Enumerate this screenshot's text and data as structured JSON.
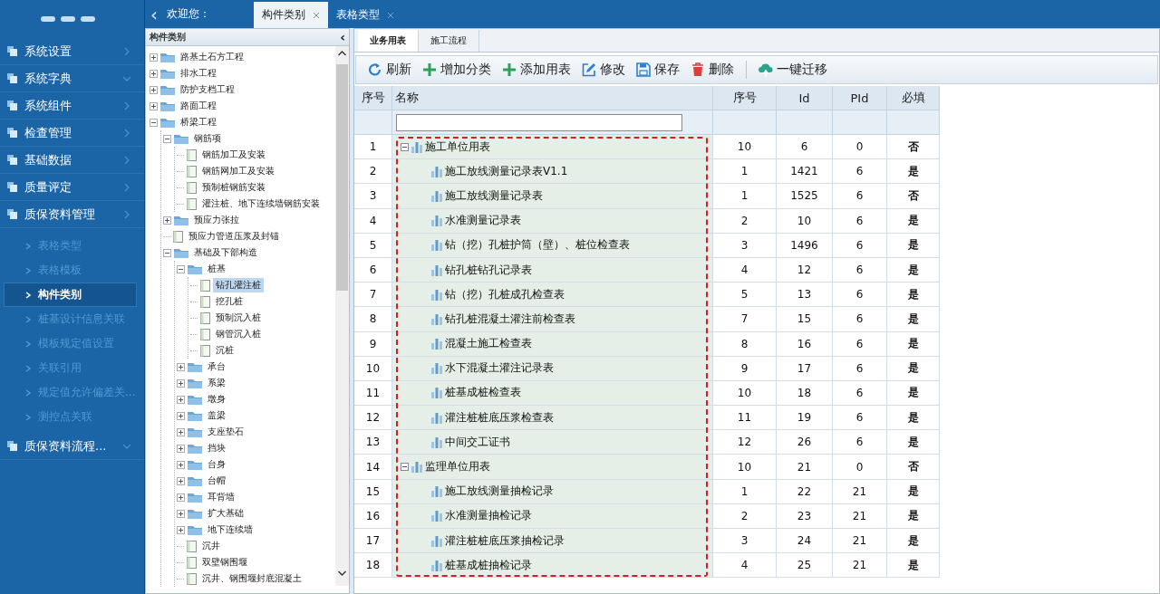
{
  "top_bar": {
    "collapse": "‹",
    "welcome": "欢迎您：",
    "tabs": [
      {
        "label": "构件类别",
        "selected": true
      },
      {
        "label": "表格类型",
        "selected": false
      }
    ]
  },
  "sidebar": {
    "items": [
      {
        "kind": "group",
        "label": "系统设置",
        "expanded": false
      },
      {
        "kind": "group",
        "label": "系统字典",
        "expanded": true
      },
      {
        "kind": "group",
        "label": "系统组件",
        "expanded": false
      },
      {
        "kind": "group",
        "label": "检查管理",
        "expanded": false
      },
      {
        "kind": "group",
        "label": "基础数据",
        "expanded": false
      },
      {
        "kind": "group",
        "label": "质量评定",
        "expanded": false
      },
      {
        "kind": "group",
        "label": "质保资料管理",
        "expanded": false
      },
      {
        "kind": "sub",
        "label": "表格类型",
        "selected": false
      },
      {
        "kind": "sub",
        "label": "表格模板",
        "selected": false
      },
      {
        "kind": "sub",
        "label": "构件类别",
        "selected": true
      },
      {
        "kind": "sub",
        "label": "桩基设计信息关联",
        "selected": false
      },
      {
        "kind": "sub",
        "label": "模板规定值设置",
        "selected": false
      },
      {
        "kind": "sub",
        "label": "关联引用",
        "selected": false
      },
      {
        "kind": "sub",
        "label": "规定值允许偏差关...",
        "selected": false
      },
      {
        "kind": "sub",
        "label": "测控点关联",
        "selected": false
      },
      {
        "kind": "group",
        "label": "质保资料流程...",
        "expanded": true
      }
    ]
  },
  "tree_panel": {
    "title": "构件类别",
    "collapse": "‹",
    "nodes": [
      {
        "kind": "folder",
        "label": "路基土石方工程",
        "expanded": false
      },
      {
        "kind": "folder",
        "label": "排水工程",
        "expanded": false
      },
      {
        "kind": "folder",
        "label": "防护支档工程",
        "expanded": false
      },
      {
        "kind": "folder",
        "label": "路面工程",
        "expanded": false
      },
      {
        "kind": "folder",
        "label": "桥梁工程",
        "expanded": true,
        "children": [
          {
            "kind": "folder",
            "label": "钢筋项",
            "expanded": true,
            "children": [
              {
                "kind": "file",
                "label": "钢筋加工及安装",
                "selected": false
              },
              {
                "kind": "file",
                "label": "钢筋网加工及安装",
                "selected": false
              },
              {
                "kind": "file",
                "label": "预制桩钢筋安装",
                "selected": false
              },
              {
                "kind": "file",
                "label": "灌注桩、地下连续墙钢筋安装",
                "selected": false
              }
            ]
          },
          {
            "kind": "folder",
            "label": "预应力张拉",
            "expanded": false
          },
          {
            "kind": "file",
            "label": "预应力管道压浆及封锚",
            "selected": false
          },
          {
            "kind": "folder",
            "label": "基础及下部构造",
            "expanded": true,
            "children": [
              {
                "kind": "folder",
                "label": "桩基",
                "expanded": true,
                "children": [
                  {
                    "kind": "file",
                    "label": "钻孔灌注桩",
                    "selected": true
                  },
                  {
                    "kind": "file",
                    "label": "挖孔桩",
                    "selected": false
                  },
                  {
                    "kind": "file",
                    "label": "预制沉入桩",
                    "selected": false
                  },
                  {
                    "kind": "file",
                    "label": "钢管沉入桩",
                    "selected": false
                  },
                  {
                    "kind": "file",
                    "label": "沉桩",
                    "selected": false
                  }
                ]
              },
              {
                "kind": "folder",
                "label": "承台",
                "expanded": false
              },
              {
                "kind": "folder",
                "label": "系梁",
                "expanded": false
              },
              {
                "kind": "folder",
                "label": "墩身",
                "expanded": false
              },
              {
                "kind": "folder",
                "label": "盖梁",
                "expanded": false
              },
              {
                "kind": "folder",
                "label": "支座垫石",
                "expanded": false
              },
              {
                "kind": "folder",
                "label": "挡块",
                "expanded": false
              },
              {
                "kind": "folder",
                "label": "台身",
                "expanded": false
              },
              {
                "kind": "folder",
                "label": "台帽",
                "expanded": false
              },
              {
                "kind": "folder",
                "label": "耳背墙",
                "expanded": false
              },
              {
                "kind": "folder",
                "label": "扩大基础",
                "expanded": false
              },
              {
                "kind": "folder",
                "label": "地下连续墙",
                "expanded": false
              },
              {
                "kind": "file",
                "label": "沉井",
                "selected": false
              },
              {
                "kind": "file",
                "label": "双壁钢围堰",
                "selected": false
              },
              {
                "kind": "file",
                "label": "沉井、钢围堰封底混凝土",
                "selected": false
              }
            ]
          }
        ]
      }
    ]
  },
  "main": {
    "tabs": [
      {
        "label": "业务用表",
        "selected": true
      },
      {
        "label": "施工流程",
        "selected": false
      }
    ],
    "toolbar": [
      {
        "kind": "refresh",
        "label": "刷新"
      },
      {
        "kind": "add",
        "label": "增加分类"
      },
      {
        "kind": "add",
        "label": "添加用表"
      },
      {
        "kind": "edit",
        "label": "修改"
      },
      {
        "kind": "save",
        "label": "保存"
      },
      {
        "kind": "delete",
        "label": "删除"
      },
      {
        "kind": "migrate",
        "label": "一键迁移"
      }
    ],
    "table": {
      "columns": [
        "序号",
        "名称",
        "序号",
        "Id",
        "PId",
        "必填"
      ],
      "rows": [
        {
          "no": "1",
          "name": "施工单位用表",
          "order": "10",
          "id": "6",
          "pid": "0",
          "required": "否",
          "expanded": true,
          "children": [
            {
              "no": "2",
              "name": "施工放线测量记录表V1.1",
              "order": "1",
              "id": "1421",
              "pid": "6",
              "required": "是"
            },
            {
              "no": "3",
              "name": "施工放线测量记录表",
              "order": "1",
              "id": "1525",
              "pid": "6",
              "required": "否"
            },
            {
              "no": "4",
              "name": "水准测量记录表",
              "order": "2",
              "id": "10",
              "pid": "6",
              "required": "是"
            },
            {
              "no": "5",
              "name": "钻（挖）孔桩护筒（壁）、桩位检查表",
              "order": "3",
              "id": "1496",
              "pid": "6",
              "required": "是"
            },
            {
              "no": "6",
              "name": "钻孔桩钻孔记录表",
              "order": "4",
              "id": "12",
              "pid": "6",
              "required": "是"
            },
            {
              "no": "7",
              "name": "钻（挖）孔桩成孔检查表",
              "order": "5",
              "id": "13",
              "pid": "6",
              "required": "是"
            },
            {
              "no": "8",
              "name": "钻孔桩混凝土灌注前检查表",
              "order": "7",
              "id": "15",
              "pid": "6",
              "required": "是"
            },
            {
              "no": "9",
              "name": "混凝土施工检查表",
              "order": "8",
              "id": "16",
              "pid": "6",
              "required": "是"
            },
            {
              "no": "10",
              "name": "水下混凝土灌注记录表",
              "order": "9",
              "id": "17",
              "pid": "6",
              "required": "是"
            },
            {
              "no": "11",
              "name": "桩基成桩检查表",
              "order": "10",
              "id": "18",
              "pid": "6",
              "required": "是"
            },
            {
              "no": "12",
              "name": "灌注桩桩底压浆检查表",
              "order": "11",
              "id": "19",
              "pid": "6",
              "required": "是"
            },
            {
              "no": "13",
              "name": "中间交工证书",
              "order": "12",
              "id": "26",
              "pid": "6",
              "required": "是"
            }
          ]
        },
        {
          "no": "14",
          "name": "监理单位用表",
          "order": "10",
          "id": "21",
          "pid": "0",
          "required": "否",
          "expanded": true,
          "children": [
            {
              "no": "15",
              "name": "施工放线测量抽检记录",
              "order": "1",
              "id": "22",
              "pid": "21",
              "required": "是"
            },
            {
              "no": "16",
              "name": "水准测量抽检记录",
              "order": "2",
              "id": "23",
              "pid": "21",
              "required": "是"
            },
            {
              "no": "17",
              "name": "灌注桩桩底压浆抽检记录",
              "order": "3",
              "id": "24",
              "pid": "21",
              "required": "是"
            },
            {
              "no": "18",
              "name": "桩基成桩抽检记录",
              "order": "4",
              "id": "25",
              "pid": "21",
              "required": "是"
            }
          ]
        }
      ]
    }
  }
}
